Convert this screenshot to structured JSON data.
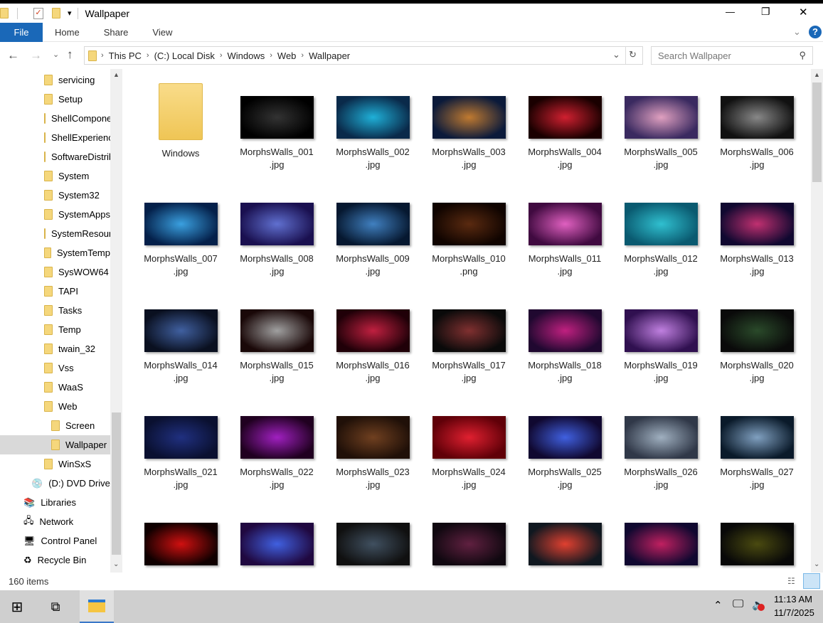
{
  "window": {
    "title": "Wallpaper",
    "minimize": "—",
    "maximize": "❐",
    "close": "✕"
  },
  "ribbon": {
    "tabs": [
      "File",
      "Home",
      "Share",
      "View"
    ],
    "help": "?"
  },
  "address": {
    "crumbs": [
      "This PC",
      "(C:) Local Disk",
      "Windows",
      "Web",
      "Wallpaper"
    ],
    "search_placeholder": "Search Wallpaper"
  },
  "sidebar": {
    "items": [
      {
        "label": "servicing",
        "type": "folder",
        "indent": 1
      },
      {
        "label": "Setup",
        "type": "folder",
        "indent": 1
      },
      {
        "label": "ShellComponents",
        "type": "folder",
        "indent": 1
      },
      {
        "label": "ShellExperiences",
        "type": "folder",
        "indent": 1
      },
      {
        "label": "SoftwareDistribution",
        "type": "folder",
        "indent": 1
      },
      {
        "label": "System",
        "type": "folder",
        "indent": 1
      },
      {
        "label": "System32",
        "type": "folder",
        "indent": 1
      },
      {
        "label": "SystemApps",
        "type": "folder",
        "indent": 1
      },
      {
        "label": "SystemResources",
        "type": "folder",
        "indent": 1
      },
      {
        "label": "SystemTemp",
        "type": "folder",
        "indent": 1
      },
      {
        "label": "SysWOW64",
        "type": "folder",
        "indent": 1
      },
      {
        "label": "TAPI",
        "type": "folder",
        "indent": 1
      },
      {
        "label": "Tasks",
        "type": "folder",
        "indent": 1
      },
      {
        "label": "Temp",
        "type": "folder",
        "indent": 1
      },
      {
        "label": "twain_32",
        "type": "folder",
        "indent": 1
      },
      {
        "label": "Vss",
        "type": "folder",
        "indent": 1
      },
      {
        "label": "WaaS",
        "type": "folder",
        "indent": 1
      },
      {
        "label": "Web",
        "type": "folder",
        "indent": 1
      },
      {
        "label": "Screen",
        "type": "folder",
        "indent": 2
      },
      {
        "label": "Wallpaper",
        "type": "folder",
        "indent": 2,
        "selected": true
      },
      {
        "label": "WinSxS",
        "type": "folder",
        "indent": 1
      },
      {
        "label": "(D:) DVD Drive",
        "type": "dvd",
        "indent": 0
      },
      {
        "label": "Libraries",
        "type": "lib",
        "indent": -1
      },
      {
        "label": "Network",
        "type": "net",
        "indent": -1
      },
      {
        "label": "Control Panel",
        "type": "cp",
        "indent": -1
      },
      {
        "label": "Recycle Bin",
        "type": "bin",
        "indent": -1
      }
    ]
  },
  "files": [
    {
      "name": "Windows",
      "ext": "",
      "folder": true
    },
    {
      "name": "MorphsWalls_001",
      ".ext": "",
      "ext": ".jpg",
      "c": [
        "#000",
        "#333"
      ]
    },
    {
      "name": "MorphsWalls_002",
      "ext": ".jpg",
      "c": [
        "#0a2a4a",
        "#1fb0d8"
      ]
    },
    {
      "name": "MorphsWalls_003",
      "ext": ".jpg",
      "c": [
        "#0b1a3a",
        "#c07a30"
      ]
    },
    {
      "name": "MorphsWalls_004",
      "ext": ".jpg",
      "c": [
        "#1a0000",
        "#d02030"
      ]
    },
    {
      "name": "MorphsWalls_005",
      "ext": ".jpg",
      "c": [
        "#3a2a60",
        "#e0a0c0"
      ]
    },
    {
      "name": "MorphsWalls_006",
      "ext": ".jpg",
      "c": [
        "#111",
        "#888"
      ]
    },
    {
      "name": "MorphsWalls_007",
      "ext": ".jpg",
      "c": [
        "#04204a",
        "#3aa0e0"
      ]
    },
    {
      "name": "MorphsWalls_008",
      "ext": ".jpg",
      "c": [
        "#1a1050",
        "#6070d0"
      ]
    },
    {
      "name": "MorphsWalls_009",
      "ext": ".jpg",
      "c": [
        "#061830",
        "#4080c0"
      ]
    },
    {
      "name": "MorphsWalls_010",
      "ext": ".png",
      "c": [
        "#100400",
        "#5a2a10"
      ]
    },
    {
      "name": "MorphsWalls_011",
      "ext": ".jpg",
      "c": [
        "#400a40",
        "#e060c0"
      ]
    },
    {
      "name": "MorphsWalls_012",
      "ext": ".jpg",
      "c": [
        "#0a5a70",
        "#30c0d0"
      ]
    },
    {
      "name": "MorphsWalls_013",
      "ext": ".jpg",
      "c": [
        "#100830",
        "#c03070"
      ]
    },
    {
      "name": "MorphsWalls_014",
      "ext": ".jpg",
      "c": [
        "#0a1020",
        "#4060a0"
      ]
    },
    {
      "name": "MorphsWalls_015",
      "ext": ".jpg",
      "c": [
        "#1a0808",
        "#a0a0a0"
      ]
    },
    {
      "name": "MorphsWalls_016",
      "ext": ".jpg",
      "c": [
        "#200008",
        "#c02040"
      ]
    },
    {
      "name": "MorphsWalls_017",
      "ext": ".jpg",
      "c": [
        "#0a0a0a",
        "#803030"
      ]
    },
    {
      "name": "MorphsWalls_018",
      "ext": ".jpg",
      "c": [
        "#200830",
        "#c02080"
      ]
    },
    {
      "name": "MorphsWalls_019",
      "ext": ".jpg",
      "c": [
        "#301050",
        "#c080e0"
      ]
    },
    {
      "name": "MorphsWalls_020",
      "ext": ".jpg",
      "c": [
        "#0a0a0a",
        "#2a4a2a"
      ]
    },
    {
      "name": "MorphsWalls_021",
      "ext": ".jpg",
      "c": [
        "#0a1030",
        "#203080"
      ]
    },
    {
      "name": "MorphsWalls_022",
      "ext": ".jpg",
      "c": [
        "#200020",
        "#a020c0"
      ]
    },
    {
      "name": "MorphsWalls_023",
      "ext": ".jpg",
      "c": [
        "#201008",
        "#704020"
      ]
    },
    {
      "name": "MorphsWalls_024",
      "ext": ".jpg",
      "c": [
        "#600008",
        "#e02030"
      ]
    },
    {
      "name": "MorphsWalls_025",
      "ext": ".jpg",
      "c": [
        "#100830",
        "#4060e0"
      ]
    },
    {
      "name": "MorphsWalls_026",
      "ext": ".jpg",
      "c": [
        "#303848",
        "#a0b0c0"
      ]
    },
    {
      "name": "MorphsWalls_027",
      "ext": ".jpg",
      "c": [
        "#0a1a2a",
        "#80a0c0"
      ]
    },
    {
      "c": [
        "#100000",
        "#d01010"
      ]
    },
    {
      "c": [
        "#200840",
        "#4060e0"
      ]
    },
    {
      "c": [
        "#101010",
        "#405060"
      ]
    },
    {
      "c": [
        "#100810",
        "#602040"
      ]
    },
    {
      "c": [
        "#101820",
        "#e04030"
      ]
    },
    {
      "c": [
        "#100830",
        "#c02060"
      ]
    },
    {
      "c": [
        "#080808",
        "#4a4a10"
      ]
    }
  ],
  "status": {
    "item_count": "160 items"
  },
  "taskbar": {
    "time": "11:13 AM",
    "date": "11/7/2025"
  }
}
